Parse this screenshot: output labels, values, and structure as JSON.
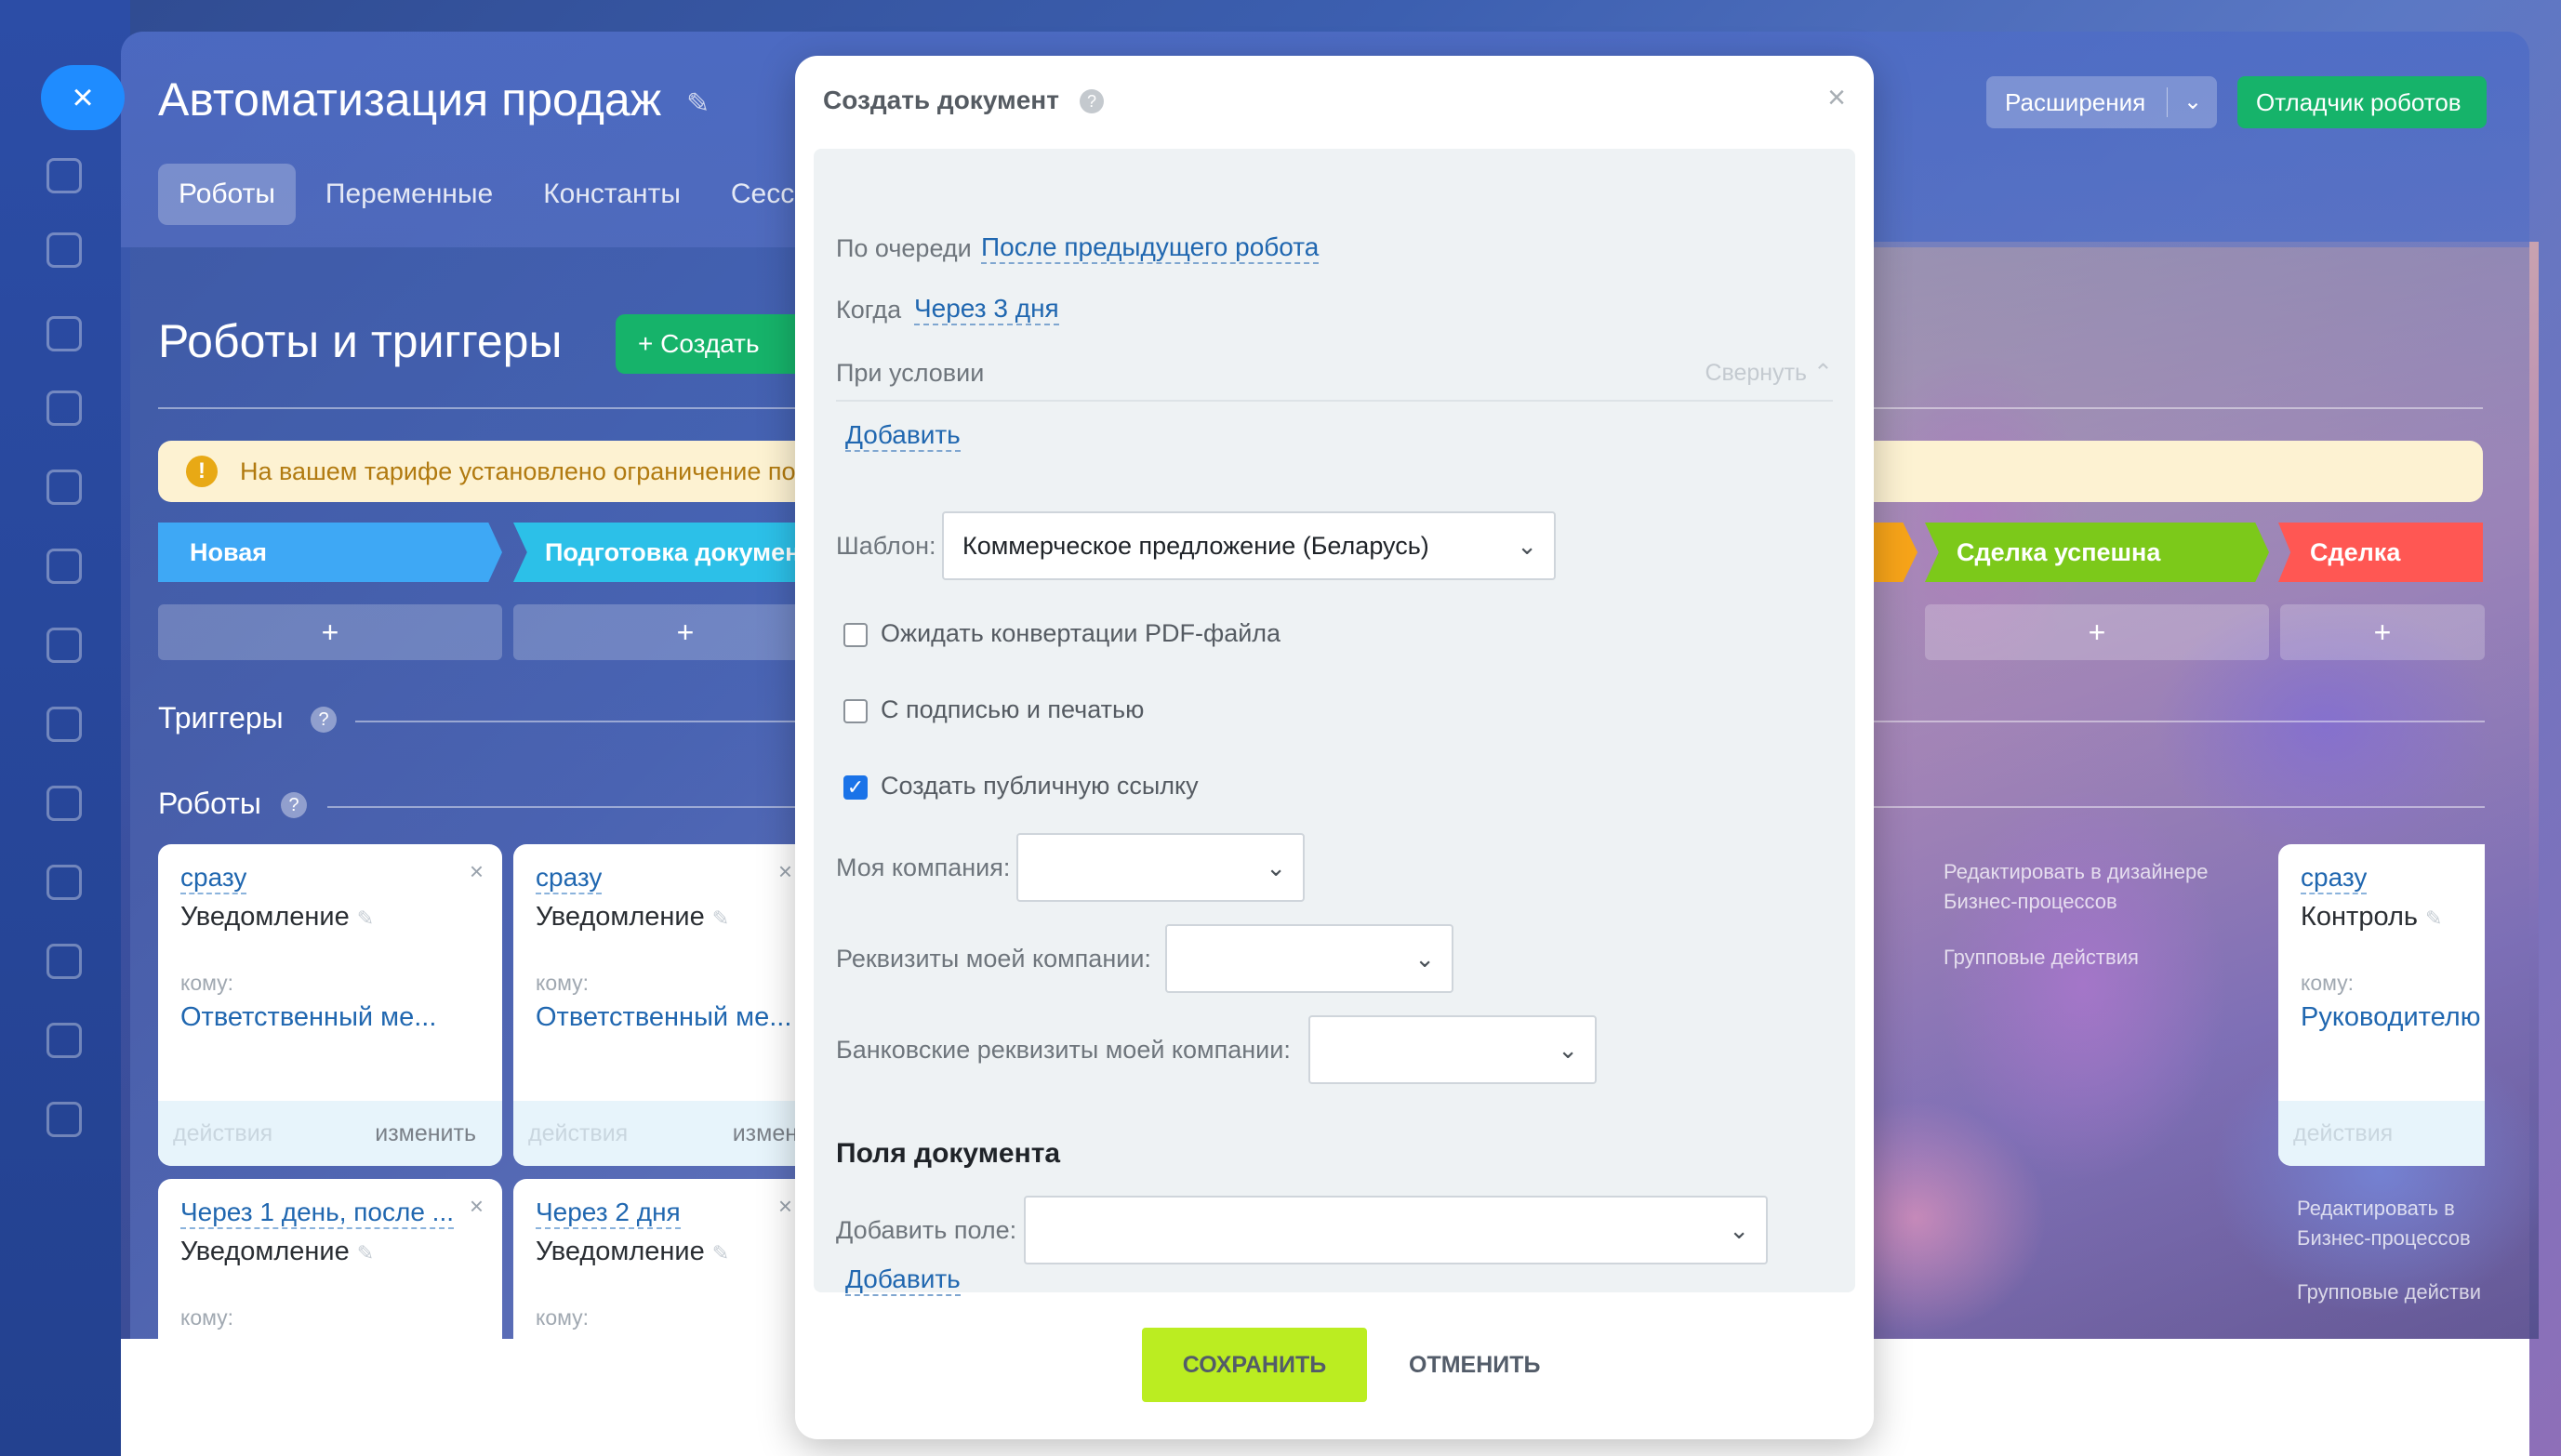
{
  "app": {
    "title": "Автоматизация продаж",
    "tabs": [
      "Роботы",
      "Переменные",
      "Константы",
      "Сесс"
    ],
    "extensions_label": "Расширения",
    "debugger_label": "Отладчик роботов"
  },
  "automation": {
    "section_title": "Роботы и триггеры",
    "create_label": "+ Создать",
    "warning": "На вашем тарифе установлено ограничение по",
    "stages": [
      "Новая",
      "Подготовка докумен",
      "Сделка успешна",
      "Сделка провал"
    ],
    "triggers_title": "Триггеры",
    "robots_title": "Роботы",
    "cards": [
      {
        "when": "сразу",
        "name": "Уведомление",
        "to": "кому:",
        "who": "Ответственный ме...",
        "actions": "действия",
        "edit": "изменить"
      },
      {
        "when": "сразу",
        "name": "Уведомление",
        "to": "кому:",
        "who": "Ответственный ме...",
        "actions": "действия",
        "edit": "измени"
      },
      {
        "when": "сразу",
        "name": "Контроль",
        "to": "кому:",
        "who": "Руководителю",
        "actions": "действия",
        "edit": ""
      },
      {
        "when": "Через 1 день, после ...",
        "name": "Уведомление",
        "to": "кому:",
        "who": "",
        "actions": "",
        "edit": ""
      },
      {
        "when": "Через 2 дня",
        "name": "Уведомление",
        "to": "кому:",
        "who": "",
        "actions": "",
        "edit": ""
      }
    ],
    "bp_link_1": "Редактировать в дизайнере Бизнес-процессов",
    "group_actions_1": "Групповые действия",
    "bp_link_2": "Редактировать в Бизнес-процессов",
    "group_actions_2": "Групповые действи"
  },
  "modal": {
    "title": "Создать документ",
    "order_label": "По очереди",
    "order_value": "После предыдущего робота",
    "when_label": "Когда",
    "when_value": "Через 3 дня",
    "condition_label": "При условии",
    "collapse_label": "Свернуть",
    "add_label": "Добавить",
    "template_label": "Шаблон:",
    "template_value": "Коммерческое предложение (Беларусь)",
    "checkboxes": [
      {
        "label": "Ожидать конвертации PDF-файла",
        "checked": false
      },
      {
        "label": "С подписью и печатью",
        "checked": false
      },
      {
        "label": "Создать публичную ссылку",
        "checked": true
      }
    ],
    "my_company_label": "Моя компания:",
    "company_details_label": "Реквизиты моей компании:",
    "bank_details_label": "Банковские реквизиты моей компании:",
    "fields_title": "Поля документа",
    "add_field_label": "Добавить поле:",
    "add_field_link": "Добавить",
    "save_label": "СОХРАНИТЬ",
    "cancel_label": "ОТМЕНИТЬ"
  },
  "colors": {
    "accent_green": "#16b36a",
    "save_green": "#bbed21",
    "link_blue": "#2067b0"
  }
}
